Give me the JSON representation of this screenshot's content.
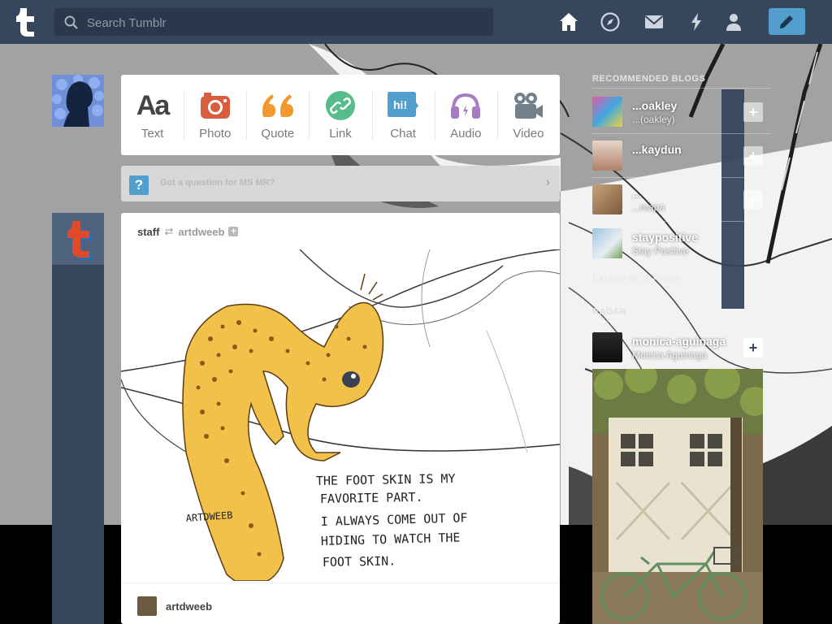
{
  "header": {
    "search_placeholder": "Search Tumblr",
    "nav": [
      "home-icon",
      "explore-icon",
      "inbox-icon",
      "activity-icon",
      "account-icon"
    ],
    "compose_icon": "pencil-icon",
    "colors": {
      "bar": "#36465d",
      "search": "#2b384b",
      "compose": "#529ecc"
    }
  },
  "post_types": [
    {
      "label": "Text",
      "icon": "text-icon",
      "color": "#444444"
    },
    {
      "label": "Photo",
      "icon": "camera-icon",
      "color": "#d95e40"
    },
    {
      "label": "Quote",
      "icon": "quote-icon",
      "color": "#f2992e"
    },
    {
      "label": "Link",
      "icon": "link-icon",
      "color": "#56bc8a"
    },
    {
      "label": "Chat",
      "icon": "chat-icon",
      "color": "#529ecc"
    },
    {
      "label": "Audio",
      "icon": "headphones-icon",
      "color": "#a77dc2"
    },
    {
      "label": "Video",
      "icon": "video-camera-icon",
      "color": "#748089"
    }
  ],
  "ask_bar": {
    "text": "Got a question for MS MR?"
  },
  "post": {
    "author": "staff",
    "reblogged_from": "artdweeb",
    "image_text": {
      "line1": "THE FOOT SKIN IS MY",
      "line2": "FAVORITE PART.",
      "line3": "I ALWAYS COME OUT OF",
      "line4": "HIDING TO WATCH THE",
      "line5": "FOOT SKIN.",
      "signature": "ARTDWEEB"
    },
    "source_blog": "artdweeb"
  },
  "right": {
    "heading": "RECOMMENDED BLOGS",
    "blogs": [
      {
        "name": "...oakley",
        "sub": "...(oakley)"
      },
      {
        "name": "...kaydun",
        "sub": ""
      },
      {
        "name": "...",
        "sub": "...mapa"
      },
      {
        "name": "staypositive",
        "sub": "Stay Positive"
      }
    ],
    "explore_text": "Explore all of Tumblr",
    "radar_heading": "RADAR",
    "radar_blog": {
      "name": "monica-aguinaga",
      "sub": "Monica Aguinaga"
    }
  }
}
